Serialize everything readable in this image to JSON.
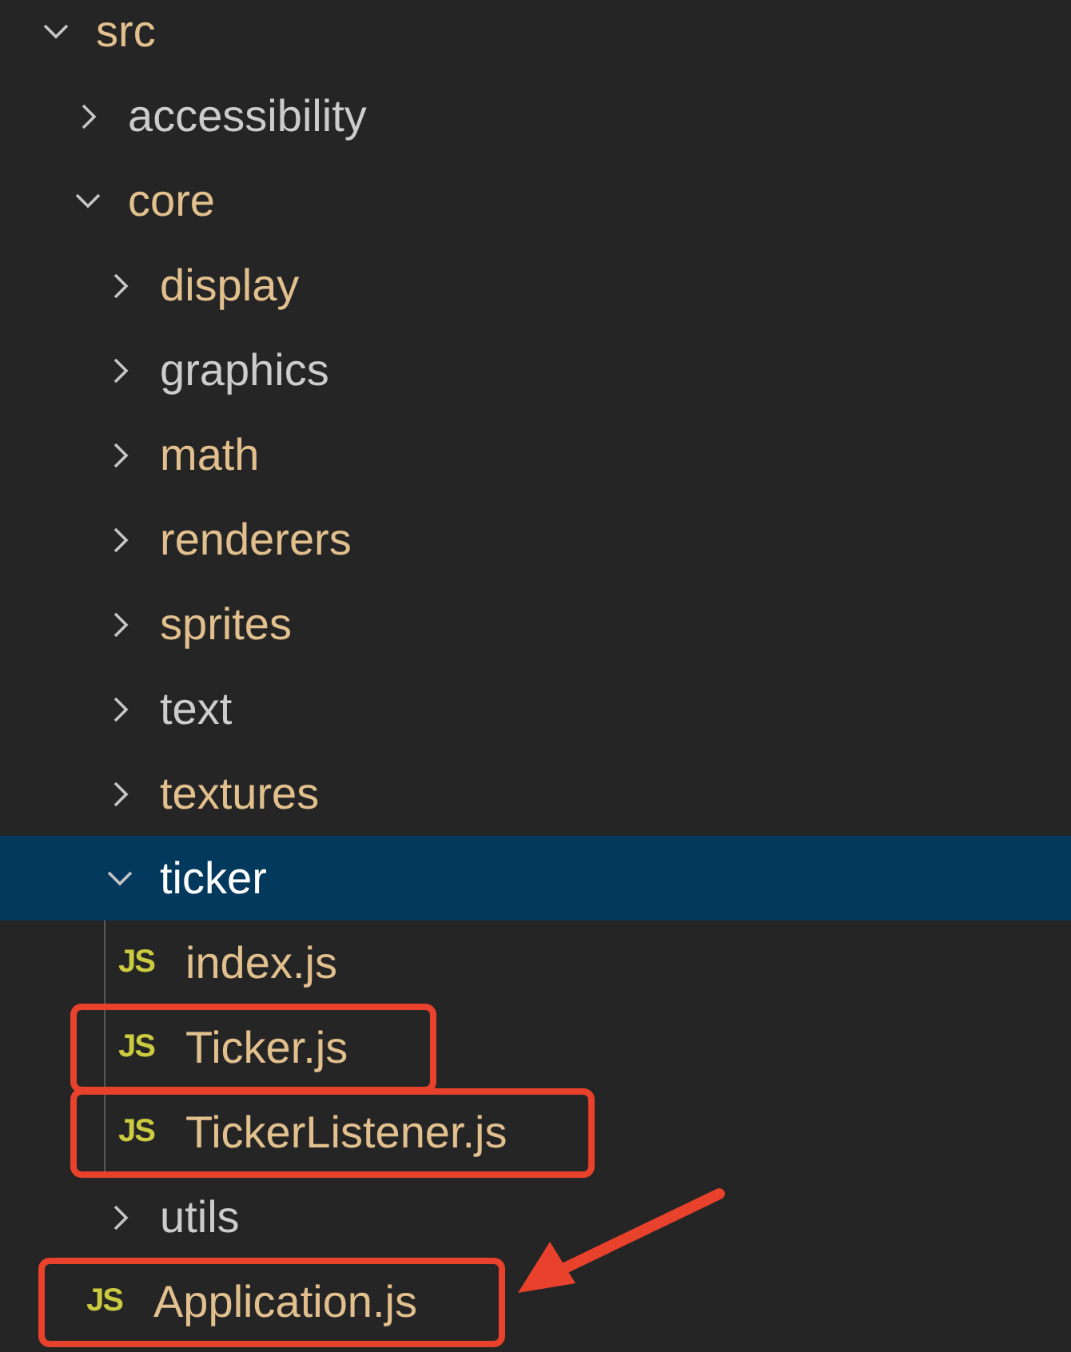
{
  "explorer": {
    "tree": [
      {
        "name": "src",
        "kind": "folder",
        "expanded": true,
        "selected": false,
        "color": "#e2c08d",
        "children": [
          {
            "name": "accessibility",
            "kind": "folder",
            "expanded": false,
            "selected": false,
            "color": "#cccccc"
          },
          {
            "name": "core",
            "kind": "folder",
            "expanded": true,
            "selected": false,
            "color": "#e2c08d",
            "children": [
              {
                "name": "display",
                "kind": "folder",
                "expanded": false,
                "selected": false,
                "color": "#e2c08d"
              },
              {
                "name": "graphics",
                "kind": "folder",
                "expanded": false,
                "selected": false,
                "color": "#cccccc"
              },
              {
                "name": "math",
                "kind": "folder",
                "expanded": false,
                "selected": false,
                "color": "#e2c08d"
              },
              {
                "name": "renderers",
                "kind": "folder",
                "expanded": false,
                "selected": false,
                "color": "#e2c08d"
              },
              {
                "name": "sprites",
                "kind": "folder",
                "expanded": false,
                "selected": false,
                "color": "#e2c08d"
              },
              {
                "name": "text",
                "kind": "folder",
                "expanded": false,
                "selected": false,
                "color": "#cccccc"
              },
              {
                "name": "textures",
                "kind": "folder",
                "expanded": false,
                "selected": false,
                "color": "#e2c08d"
              },
              {
                "name": "ticker",
                "kind": "folder",
                "expanded": true,
                "selected": true,
                "color": "#ffffff",
                "children": [
                  {
                    "name": "index.js",
                    "kind": "file",
                    "icon": "JS",
                    "selected": false,
                    "color": "#e2c08d",
                    "boxed": false,
                    "arrow": false
                  },
                  {
                    "name": "Ticker.js",
                    "kind": "file",
                    "icon": "JS",
                    "selected": false,
                    "color": "#e2c08d",
                    "boxed": true,
                    "arrow": false
                  },
                  {
                    "name": "TickerListener.js",
                    "kind": "file",
                    "icon": "JS",
                    "selected": false,
                    "color": "#e2c08d",
                    "boxed": true,
                    "arrow": false
                  }
                ]
              },
              {
                "name": "utils",
                "kind": "folder",
                "expanded": false,
                "selected": false,
                "color": "#cccccc"
              },
              {
                "name": "Application.js",
                "kind": "file",
                "icon": "JS",
                "selected": false,
                "color": "#e2c08d",
                "boxed": true,
                "arrow": true
              }
            ]
          }
        ]
      }
    ]
  }
}
